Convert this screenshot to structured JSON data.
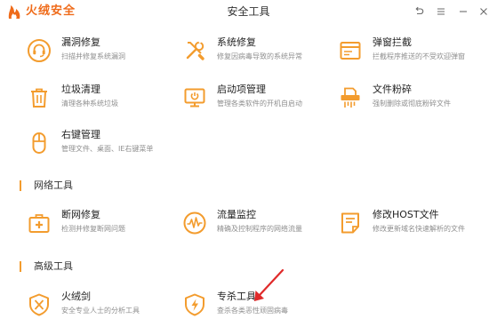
{
  "app": {
    "brand": "火绒安全",
    "title": "安全工具"
  },
  "colors": {
    "accent": "#f39c2e",
    "brand": "#ef6b1a",
    "annotation": "#e02a2a"
  },
  "window_controls": [
    {
      "name": "back-icon"
    },
    {
      "name": "menu-icon"
    },
    {
      "name": "minimize-icon"
    },
    {
      "name": "close-icon"
    }
  ],
  "sections": {
    "network": "网络工具",
    "advanced": "高级工具"
  },
  "tools": [
    {
      "icon": "headset-icon",
      "name": "漏洞修复",
      "desc": "扫描并修复系统漏洞"
    },
    {
      "icon": "wrench-screwdriver-icon",
      "name": "系统修复",
      "desc": "修复因病毒导致的系统异常"
    },
    {
      "icon": "popup-block-icon",
      "name": "弹窗拦截",
      "desc": "拦截程序推送的不受欢迎弹窗"
    },
    {
      "icon": "trash-icon",
      "name": "垃圾清理",
      "desc": "清理各种系统垃圾"
    },
    {
      "icon": "startup-monitor-icon",
      "name": "启动项管理",
      "desc": "管理各类软件的开机自启动"
    },
    {
      "icon": "shredder-icon",
      "name": "文件粉碎",
      "desc": "强制删除或彻底粉碎文件"
    },
    {
      "icon": "mouse-icon",
      "name": "右键管理",
      "desc": "管理文件、桌面、IE右键菜单"
    },
    {
      "icon": "first-aid-kit-icon",
      "name": "断网修复",
      "desc": "检测并修复断网问题"
    },
    {
      "icon": "traffic-gauge-icon",
      "name": "流量监控",
      "desc": "精确及控制程序的网络流量"
    },
    {
      "icon": "hosts-file-icon",
      "name": "修改HOST文件",
      "desc": "修改更新域名快速解析的文件"
    },
    {
      "icon": "sword-shield-icon",
      "name": "火绒剑",
      "desc": "安全专业人士的分析工具"
    },
    {
      "icon": "antivirus-shield-icon",
      "name": "专杀工具",
      "desc": "查杀各类恶性顽固病毒"
    }
  ]
}
